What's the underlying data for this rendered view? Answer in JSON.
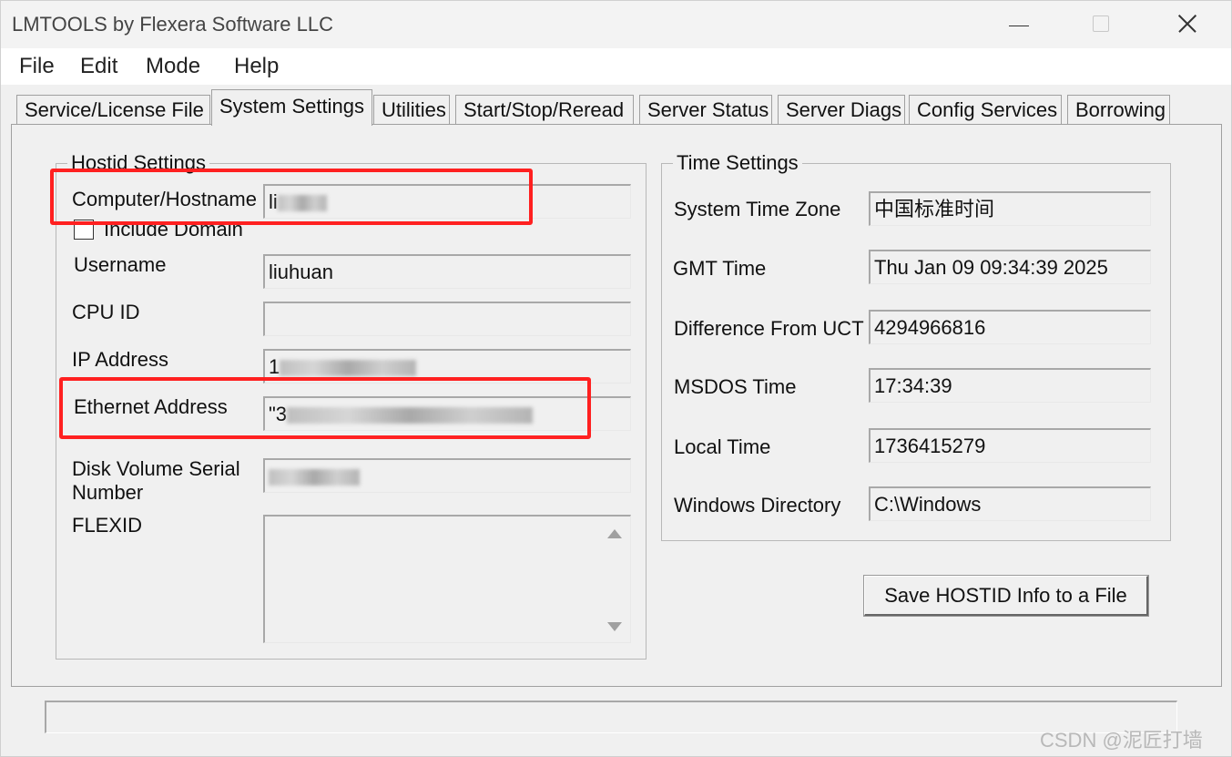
{
  "window": {
    "title": "LMTOOLS by Flexera Software LLC"
  },
  "menu": [
    "File",
    "Edit",
    "Mode",
    "Help"
  ],
  "tabs": [
    "Service/License File",
    "System Settings",
    "Utilities",
    "Start/Stop/Reread",
    "Server Status",
    "Server Diags",
    "Config Services",
    "Borrowing"
  ],
  "active_tab": "System Settings",
  "hostid": {
    "title": "Hostid Settings",
    "computer_label": "Computer/Hostname",
    "computer_value": "li",
    "include_domain_label": "Include Domain",
    "username_label": "Username",
    "username_value": "liuhuan",
    "cpuid_label": "CPU ID",
    "cpuid_value": "",
    "ip_label": "IP Address",
    "ip_value": "1",
    "ethernet_label": "Ethernet Address",
    "ethernet_value": "\"3",
    "disk_label_1": "Disk Volume Serial",
    "disk_label_2": "Number",
    "disk_value": "",
    "flexid_label": "FLEXID"
  },
  "time": {
    "title": "Time Settings",
    "tz_label": "System Time Zone",
    "tz_value": "中国标准时间",
    "gmt_label": "GMT Time",
    "gmt_value": "Thu Jan 09 09:34:39 2025",
    "diff_label": "Difference From UCT",
    "diff_value": "4294966816",
    "msdos_label": "MSDOS Time",
    "msdos_value": "17:34:39",
    "local_label": "Local Time",
    "local_value": "1736415279",
    "windir_label": "Windows Directory",
    "windir_value": "C:\\Windows"
  },
  "save_button": "Save HOSTID Info to a File",
  "watermark": "CSDN @泥匠打墙"
}
